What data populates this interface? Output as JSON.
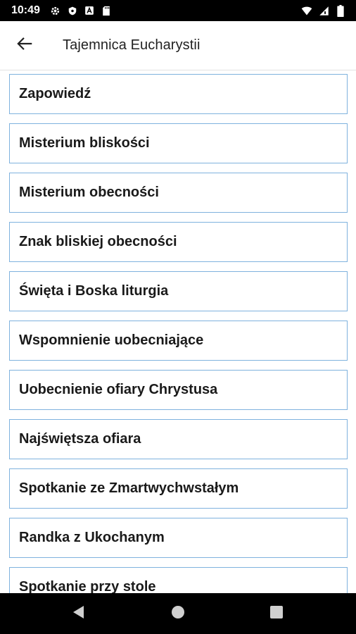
{
  "status_bar": {
    "time": "10:49",
    "left_icons": [
      "settings-icon",
      "shield-icon",
      "a-badge-icon",
      "sd-card-icon"
    ],
    "right_icons": [
      "wifi-icon",
      "signal-icon",
      "battery-icon"
    ]
  },
  "app_bar": {
    "back_icon": "arrow-left-icon",
    "title": "Tajemnica Eucharystii"
  },
  "list": {
    "items": [
      {
        "label": "Zapowiedź"
      },
      {
        "label": "Misterium bliskości"
      },
      {
        "label": "Misterium obecności"
      },
      {
        "label": "Znak bliskiej obecności"
      },
      {
        "label": "Święta i Boska liturgia"
      },
      {
        "label": "Wspomnienie uobecniające"
      },
      {
        "label": "Uobecnienie ofiary Chrystusa"
      },
      {
        "label": "Najświętsza ofiara"
      },
      {
        "label": "Spotkanie ze Zmartwychwstałym"
      },
      {
        "label": "Randka z Ukochanym"
      },
      {
        "label": "Spotkanie przy stole"
      }
    ]
  },
  "nav_bar": {
    "icons": [
      "back-triangle-icon",
      "home-circle-icon",
      "recents-square-icon"
    ]
  },
  "colors": {
    "item_border": "#7fb2de",
    "status_bar": "#000000",
    "nav_bar": "#000000"
  }
}
